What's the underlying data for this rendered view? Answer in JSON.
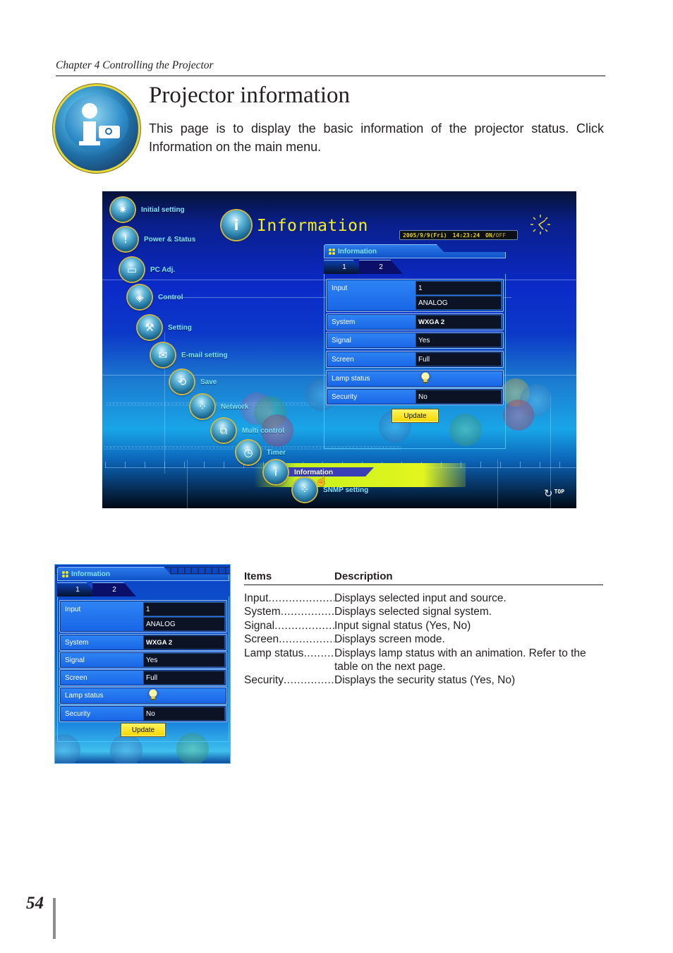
{
  "header": {
    "chapter": "Chapter 4 Controlling the Projector"
  },
  "section": {
    "icon": "information-projector-icon",
    "title": "Projector information",
    "intro_part1": "This page is to display the basic information of the projector status. Click ",
    "intro_emphasis": "Information",
    "intro_part2": " on the main menu."
  },
  "screenshot": {
    "page_title": "Information",
    "datetime": {
      "date": "2005/9/9(Fri)",
      "time": "14:23:24",
      "on": "ON/",
      "off": "OFF"
    },
    "menu": [
      {
        "label": "Initial setting",
        "icon": "initial-setting-icon"
      },
      {
        "label": "Power & Status",
        "icon": "power-status-icon"
      },
      {
        "label": "PC Adj.",
        "icon": "pc-adjust-icon"
      },
      {
        "label": "Control",
        "icon": "control-icon"
      },
      {
        "label": "Setting",
        "icon": "setting-icon"
      },
      {
        "label": "E-mail setting",
        "icon": "email-icon"
      },
      {
        "label": "Save",
        "icon": "save-icon"
      },
      {
        "label": "Network",
        "icon": "network-icon"
      },
      {
        "label": "Multi control",
        "icon": "multi-control-icon"
      },
      {
        "label": "Timer",
        "icon": "timer-icon"
      },
      {
        "label": "Information",
        "icon": "information-icon",
        "selected": true
      },
      {
        "label": "SNMP setting",
        "icon": "snmp-icon"
      }
    ],
    "top_button": "TOP"
  },
  "panel": {
    "title": "Information",
    "tabs": [
      "1",
      "2"
    ],
    "rows": {
      "input": {
        "label": "Input",
        "value": "1",
        "source": "ANALOG"
      },
      "system": {
        "label": "System",
        "value": "WXGA 2"
      },
      "signal": {
        "label": "Signal",
        "value": "Yes"
      },
      "screen": {
        "label": "Screen",
        "value": "Full"
      },
      "lamp": {
        "label": "Lamp status",
        "value_icon": "lamp-bulb-icon"
      },
      "security": {
        "label": "Security",
        "value": "No"
      }
    },
    "update_label": "Update"
  },
  "description_table": {
    "headers": [
      "Items",
      "Description"
    ],
    "rows": [
      {
        "item": "Input ",
        "text": "Displays selected input and source."
      },
      {
        "item": "System",
        "text": "Displays selected signal system."
      },
      {
        "item": "Signal",
        "text": "Input signal status (Yes, No)"
      },
      {
        "item": "Screen ",
        "text": "Displays screen mode."
      },
      {
        "item": "Lamp status",
        "text": "Displays lamp status with an animation. Refer to the table on the next page."
      },
      {
        "item": "Security ",
        "text": "Displays the security status (Yes, No)"
      }
    ]
  },
  "footer": {
    "page_number": "54"
  }
}
